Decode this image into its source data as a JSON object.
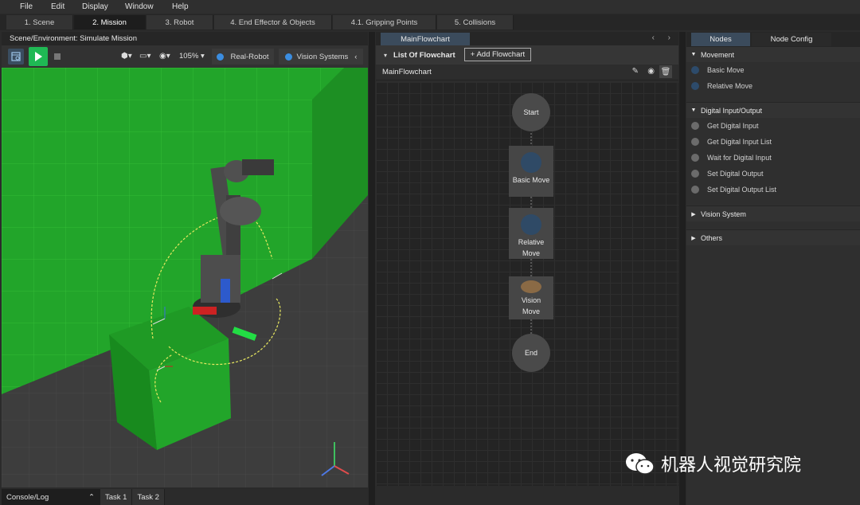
{
  "menu": [
    "File",
    "Edit",
    "Display",
    "Window",
    "Help"
  ],
  "stages": [
    "1. Scene",
    "2. Mission",
    "3. Robot",
    "4. End Effector & Objects",
    "4.1. Gripping Points",
    "5. Collisions"
  ],
  "left": {
    "title": "Scene/Environment: Simulate Mission",
    "zoom": "105%",
    "real_robot": "Real-Robot",
    "vision_systems": "Vision Systems",
    "console_tabs": [
      "Console/Log",
      "Task 1",
      "Task 2"
    ]
  },
  "mid": {
    "tab": "MainFlowchart",
    "list_label": "List Of Flowchart",
    "add_flowchart": "+ Add Flowchart",
    "flowchart_name": "MainFlowchart",
    "nodes": {
      "start": "Start",
      "basic_move": "Basic Move",
      "relative_move_1": "Relative",
      "relative_move_2": "Move",
      "vision_move_1": "Vision",
      "vision_move_2": "Move",
      "end": "End"
    }
  },
  "right": {
    "tabs": [
      "Nodes",
      "Node Config"
    ],
    "movement": "Movement",
    "movement_items": [
      "Basic Move",
      "Relative Move"
    ],
    "digital_io": "Digital Input/Output",
    "digital_items": [
      "Get Digital Input",
      "Get Digital Input List",
      "Wait for Digital Input",
      "Set Digital Output",
      "Set Digital Output List"
    ],
    "vision_system": "Vision System",
    "others": "Others"
  },
  "watermark": "机器人视觉研究院",
  "colors": {
    "accent_green": "#1fb954",
    "floor_green": "#22a52a",
    "node_blue": "#2f4a66",
    "tab_blue": "#3b4b5c"
  }
}
